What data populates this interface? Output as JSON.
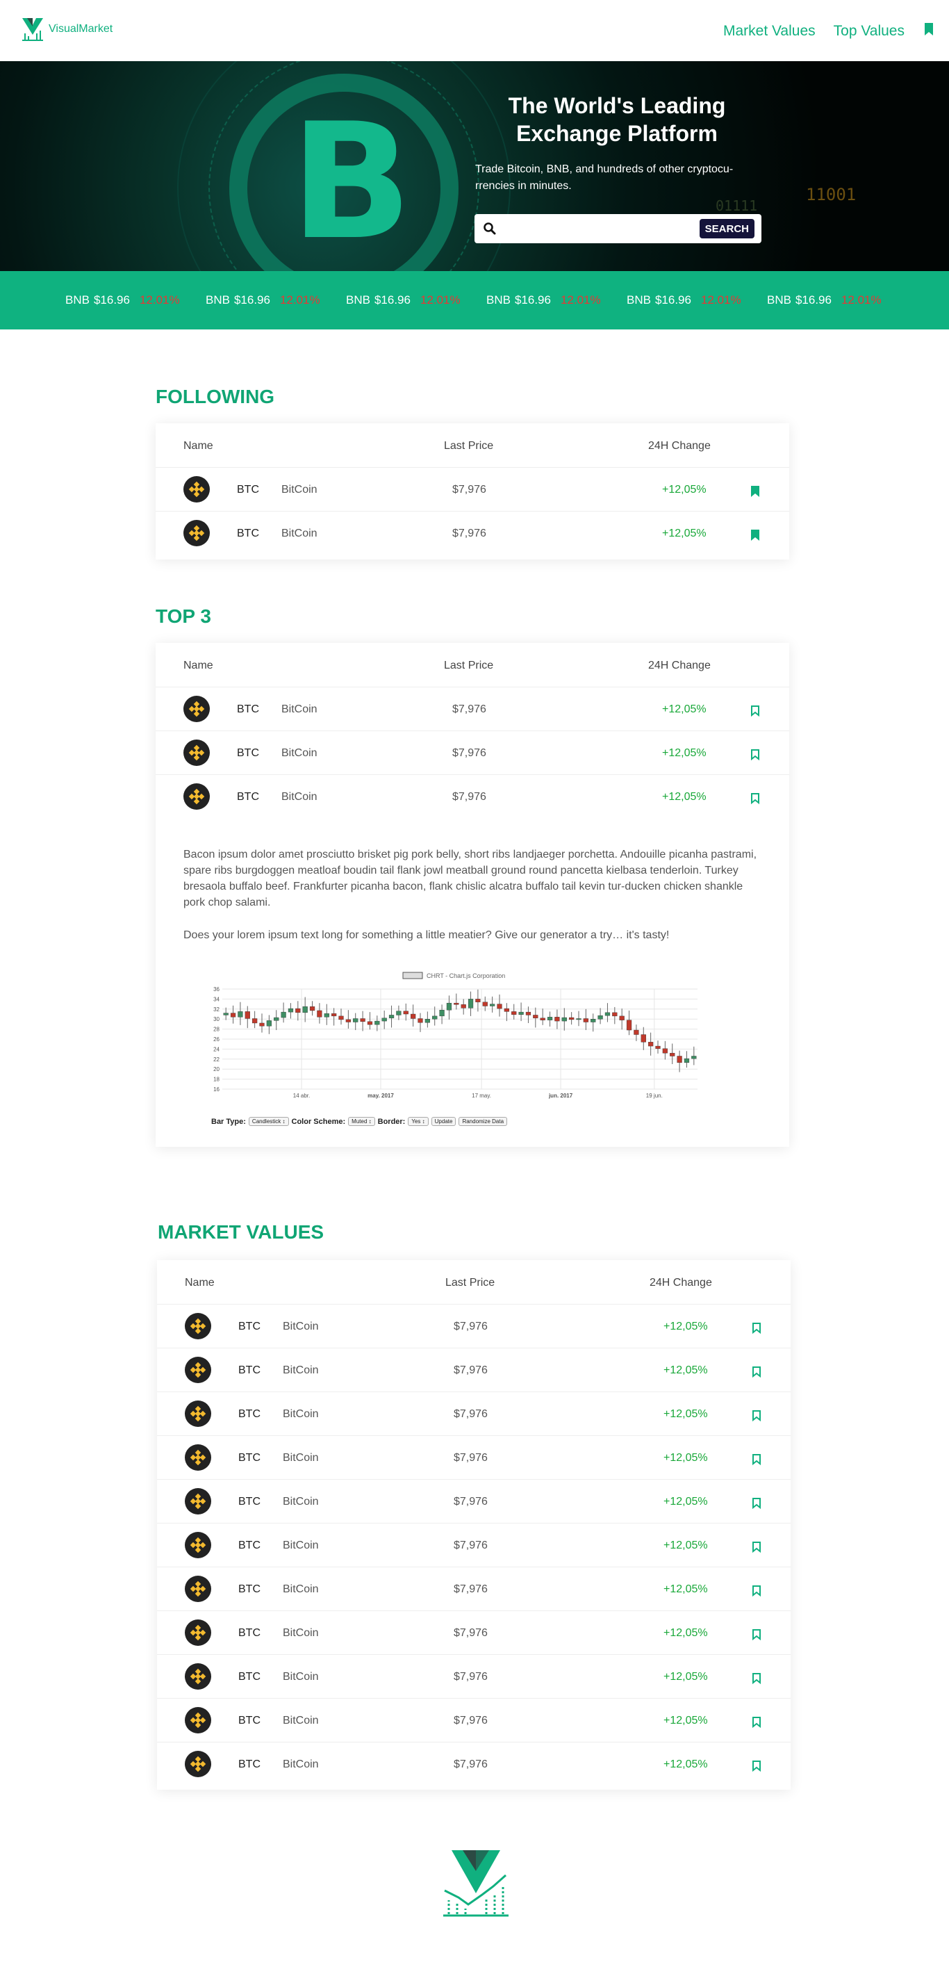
{
  "header": {
    "brand": "VisualMarket",
    "nav": [
      "Market Values",
      "Top Values"
    ]
  },
  "hero": {
    "title": "The World's Leading Exchange Platform",
    "subtitle": "Trade Bitcoin, BNB, and hundreds of other cryptocu-rrencies in minutes.",
    "search_placeholder": "",
    "search_button": "SEARCH",
    "bg_code": "11001",
    "bg_code2": "01111"
  },
  "ticker": [
    {
      "symbol": "BNB",
      "price": "$16.96",
      "change": "12.01%"
    },
    {
      "symbol": "BNB",
      "price": "$16.96",
      "change": "12.01%"
    },
    {
      "symbol": "BNB",
      "price": "$16.96",
      "change": "12.01%"
    },
    {
      "symbol": "BNB",
      "price": "$16.96",
      "change": "12.01%"
    },
    {
      "symbol": "BNB",
      "price": "$16.96",
      "change": "12.01%"
    },
    {
      "symbol": "BNB",
      "price": "$16.96",
      "change": "12.01%"
    }
  ],
  "columns": {
    "name": "Name",
    "last_price": "Last Price",
    "change": "24H Change"
  },
  "following": {
    "title": "FOLLOWING",
    "rows": [
      {
        "symbol": "BTC",
        "name": "BitCoin",
        "price": "$7,976",
        "change": "+12,05%",
        "saved": true
      },
      {
        "symbol": "BTC",
        "name": "BitCoin",
        "price": "$7,976",
        "change": "+12,05%",
        "saved": true
      }
    ]
  },
  "top3": {
    "title": "TOP 3",
    "rows": [
      {
        "symbol": "BTC",
        "name": "BitCoin",
        "price": "$7,976",
        "change": "+12,05%",
        "saved": false
      },
      {
        "symbol": "BTC",
        "name": "BitCoin",
        "price": "$7,976",
        "change": "+12,05%",
        "saved": false
      },
      {
        "symbol": "BTC",
        "name": "BitCoin",
        "price": "$7,976",
        "change": "+12,05%",
        "saved": false
      }
    ],
    "paragraph1": "Bacon ipsum dolor amet prosciutto brisket pig pork belly, short ribs landjaeger porchetta. Andouille picanha pastrami, spare ribs burgdoggen meatloaf boudin tail flank jowl meatball ground round pancetta kielbasa tenderloin. Turkey bresaola buffalo beef. Frankfurter picanha bacon, flank chislic alcatra buffalo tail kevin tur-ducken chicken shankle pork chop salami.",
    "paragraph2": "Does your lorem ipsum text long for something a little meatier? Give our generator a try… it's tasty!",
    "controls": {
      "bar_type_label": "Bar Type:",
      "bar_type_value": "Candlestick",
      "color_scheme_label": "Color Scheme:",
      "color_scheme_value": "Muted",
      "border_label": "Border:",
      "border_value": "Yes",
      "update": "Update",
      "randomize": "Randomize Data"
    }
  },
  "chart_data": {
    "type": "candlestick",
    "title": "CHRT - Chart.js Corporation",
    "xlabel": "",
    "ylabel": "",
    "ylim": [
      16,
      36
    ],
    "y_ticks": [
      16,
      18,
      20,
      22,
      24,
      26,
      28,
      30,
      32,
      34,
      36
    ],
    "x_tick_labels": [
      "14 abr.",
      "may. 2017",
      "17 may.",
      "jun. 2017",
      "19 jun."
    ],
    "grid": true,
    "colors": {
      "up": "#3e8e63",
      "down": "#c0392b",
      "wick": "#666666"
    },
    "closes": [
      31.2,
      30.4,
      31.5,
      30.1,
      29.2,
      28.6,
      29.7,
      30.3,
      31.4,
      32.1,
      31.3,
      32.5,
      31.7,
      30.4,
      31.1,
      30.6,
      29.9,
      29.4,
      30.1,
      29.5,
      28.9,
      29.6,
      30.2,
      30.8,
      31.6,
      31.0,
      30.1,
      29.3,
      30.0,
      30.6,
      31.8,
      33.2,
      32.9,
      32.2,
      34.0,
      33.4,
      32.6,
      33.0,
      32.1,
      31.5,
      30.9,
      31.4,
      30.8,
      30.2,
      29.8,
      30.4,
      29.6,
      30.3,
      29.9,
      30.1,
      29.4,
      30.0,
      30.7,
      31.3,
      30.6,
      29.8,
      27.8,
      26.9,
      25.4,
      24.6,
      24.1,
      23.2,
      22.6,
      21.3,
      22.1,
      22.6
    ]
  },
  "market": {
    "title": "MARKET VALUES",
    "rows": [
      {
        "symbol": "BTC",
        "name": "BitCoin",
        "price": "$7,976",
        "change": "+12,05%",
        "saved": false
      },
      {
        "symbol": "BTC",
        "name": "BitCoin",
        "price": "$7,976",
        "change": "+12,05%",
        "saved": false
      },
      {
        "symbol": "BTC",
        "name": "BitCoin",
        "price": "$7,976",
        "change": "+12,05%",
        "saved": false
      },
      {
        "symbol": "BTC",
        "name": "BitCoin",
        "price": "$7,976",
        "change": "+12,05%",
        "saved": false
      },
      {
        "symbol": "BTC",
        "name": "BitCoin",
        "price": "$7,976",
        "change": "+12,05%",
        "saved": false
      },
      {
        "symbol": "BTC",
        "name": "BitCoin",
        "price": "$7,976",
        "change": "+12,05%",
        "saved": false
      },
      {
        "symbol": "BTC",
        "name": "BitCoin",
        "price": "$7,976",
        "change": "+12,05%",
        "saved": false
      },
      {
        "symbol": "BTC",
        "name": "BitCoin",
        "price": "$7,976",
        "change": "+12,05%",
        "saved": false
      },
      {
        "symbol": "BTC",
        "name": "BitCoin",
        "price": "$7,976",
        "change": "+12,05%",
        "saved": false
      },
      {
        "symbol": "BTC",
        "name": "BitCoin",
        "price": "$7,976",
        "change": "+12,05%",
        "saved": false
      },
      {
        "symbol": "BTC",
        "name": "BitCoin",
        "price": "$7,976",
        "change": "+12,05%",
        "saved": false
      }
    ]
  },
  "colors": {
    "brand": "#10b07f",
    "ticker_bg": "#0fb280",
    "negative": "#e53935",
    "positive": "#19a839",
    "button_dark": "#15143a"
  }
}
